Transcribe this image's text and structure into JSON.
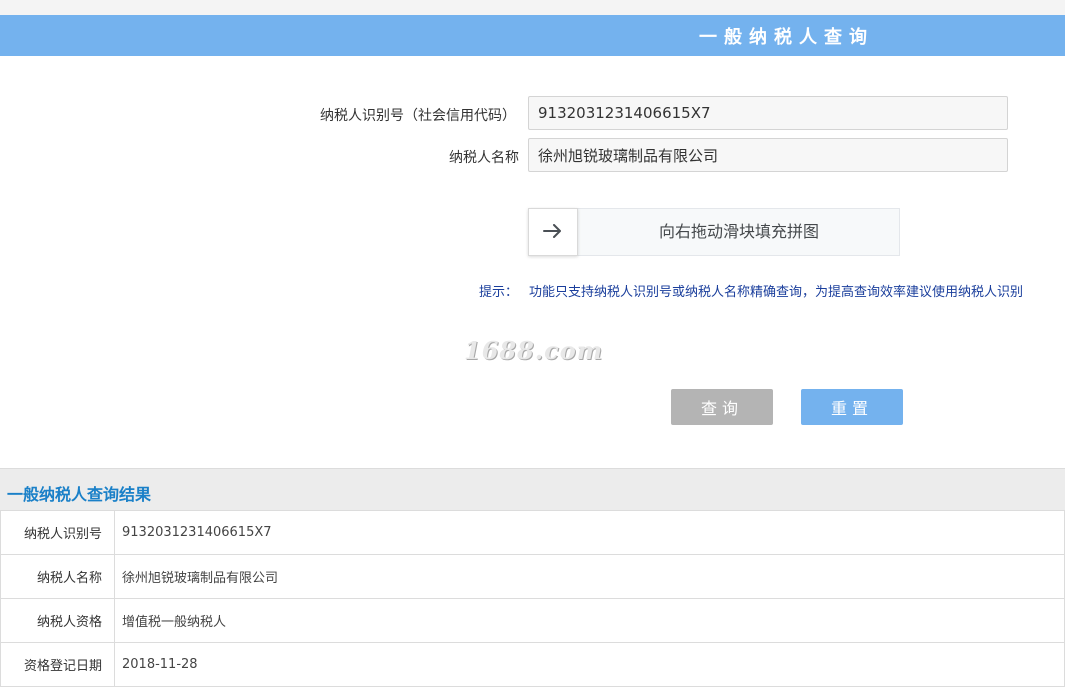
{
  "header": {
    "title": "一般纳税人查询"
  },
  "form": {
    "taxpayer_id_label": "纳税人识别号（社会信用代码）",
    "taxpayer_id_value": "9132031231406615X7",
    "taxpayer_name_label": "纳税人名称",
    "taxpayer_name_value": "徐州旭锐玻璃制品有限公司"
  },
  "captcha": {
    "text": "向右拖动滑块填充拼图",
    "handle_icon": "arrow-right-icon"
  },
  "tip": {
    "label": "提示：",
    "text": "功能只支持纳税人识别号或纳税人名称精确查询，为提高查询效率建议使用纳税人识别"
  },
  "watermark": "1688.com",
  "buttons": {
    "query": "查询",
    "reset": "重置"
  },
  "results": {
    "title": "一般纳税人查询结果",
    "rows": [
      {
        "label": "纳税人识别号",
        "value": "9132031231406615X7"
      },
      {
        "label": "纳税人名称",
        "value": "徐州旭锐玻璃制品有限公司"
      },
      {
        "label": "纳税人资格",
        "value": "增值税一般纳税人"
      },
      {
        "label": "资格登记日期",
        "value": "2018-11-28"
      }
    ]
  },
  "colors": {
    "header_bar": "#74b2ee",
    "query_button": "#b4b4b4",
    "reset_button": "#74b2ee",
    "results_title": "#1a80c8",
    "tip_text": "#1a3e9c"
  }
}
